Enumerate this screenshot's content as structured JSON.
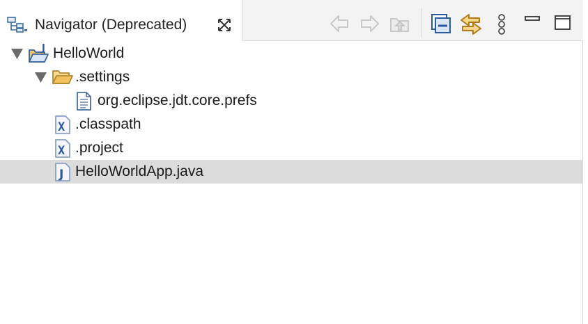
{
  "view": {
    "tab_title": "Navigator (Deprecated)",
    "tab_icon": "navigator-icon",
    "close_icon": "close-icon"
  },
  "toolbar": {
    "buttons": [
      {
        "name": "back-button",
        "icon": "arrow-left-icon",
        "enabled": false
      },
      {
        "name": "forward-button",
        "icon": "arrow-right-icon",
        "enabled": false
      },
      {
        "name": "up-button",
        "icon": "up-folder-icon",
        "enabled": false
      },
      {
        "name": "collapse-all-button",
        "icon": "collapse-all-icon",
        "enabled": true
      },
      {
        "name": "link-with-editor-button",
        "icon": "link-with-editor-icon",
        "enabled": true
      },
      {
        "name": "view-menu-button",
        "icon": "vertical-dots-icon",
        "enabled": true
      },
      {
        "name": "minimize-button",
        "icon": "minimize-icon",
        "enabled": true
      },
      {
        "name": "maximize-button",
        "icon": "maximize-icon",
        "enabled": true
      }
    ]
  },
  "tree": {
    "items": [
      {
        "label": "HelloWorld",
        "icon": "java-project-icon",
        "expanded": true,
        "selected": false
      },
      {
        "label": ".settings",
        "icon": "open-folder-icon",
        "expanded": true,
        "selected": false
      },
      {
        "label": "org.eclipse.jdt.core.prefs",
        "icon": "text-file-icon",
        "selected": false
      },
      {
        "label": ".classpath",
        "icon": "xml-file-icon",
        "selected": false
      },
      {
        "label": ".project",
        "icon": "xml-file-icon",
        "selected": false
      },
      {
        "label": "HelloWorldApp.java",
        "icon": "java-file-icon",
        "selected": true
      }
    ]
  },
  "colors": {
    "selection": "#dcdcdc",
    "folder": "#f2c25e",
    "java_blue": "#2c5aa0",
    "disabled_icon": "#c8c8c8",
    "accent_gold": "#c8902a"
  }
}
